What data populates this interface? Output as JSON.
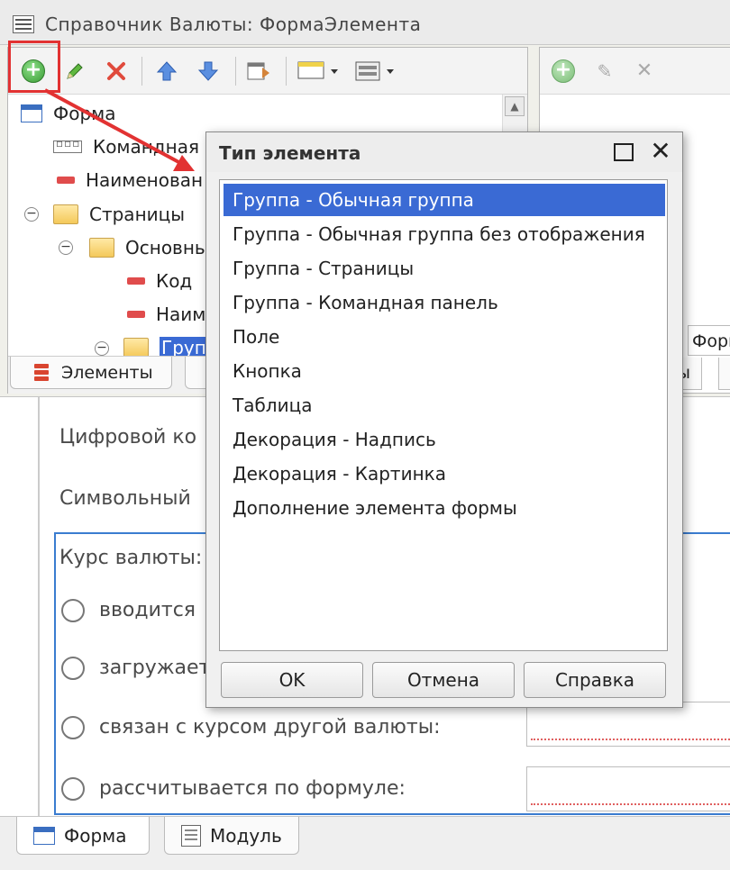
{
  "window": {
    "title": "Справочник Валюты: ФормаЭлемента"
  },
  "tree": {
    "items": [
      {
        "label": "Форма"
      },
      {
        "label": "Командная п"
      },
      {
        "label": "Наименован"
      },
      {
        "label": "Страницы"
      },
      {
        "label": "Основны"
      },
      {
        "label": "Код"
      },
      {
        "label": "Наим"
      },
      {
        "label": "Групп"
      }
    ],
    "tabs": [
      {
        "label": "Элементы"
      }
    ]
  },
  "right_panel": {
    "partial_label": "Форм",
    "partial_tab": "ы"
  },
  "preview": {
    "digital_code_label": "Цифровой ко",
    "symbol_label": "Символьный",
    "rate_group_label": "Курс валюты:",
    "radios": [
      {
        "label": "вводится"
      },
      {
        "label": "загружает"
      },
      {
        "label": "связан с курсом другой валюты:"
      },
      {
        "label": "рассчитывается по формуле:"
      }
    ]
  },
  "bottom_tabs": [
    {
      "label": "Форма"
    },
    {
      "label": "Модуль"
    }
  ],
  "dialog": {
    "title": "Тип элемента",
    "items": [
      {
        "label": "Группа - Обычная группа"
      },
      {
        "label": "Группа - Обычная группа без отображения"
      },
      {
        "label": "Группа - Страницы"
      },
      {
        "label": "Группа - Командная панель"
      },
      {
        "label": "Поле"
      },
      {
        "label": "Кнопка"
      },
      {
        "label": "Таблица"
      },
      {
        "label": "Декорация - Надпись"
      },
      {
        "label": "Декорация - Картинка"
      },
      {
        "label": "Дополнение элемента формы"
      }
    ],
    "selected_index": 0,
    "buttons": {
      "ok": "OK",
      "cancel": "Отмена",
      "help": "Справка"
    }
  },
  "colors": {
    "selection": "#3a6ad4",
    "annotation_red": "#e23232",
    "group_border": "#3a7cd0"
  },
  "icons": [
    "add-icon",
    "edit-icon",
    "delete-icon",
    "move-up-icon",
    "move-down-icon",
    "form-icon",
    "folder-icon",
    "field-icon",
    "maximize-icon",
    "close-icon"
  ]
}
